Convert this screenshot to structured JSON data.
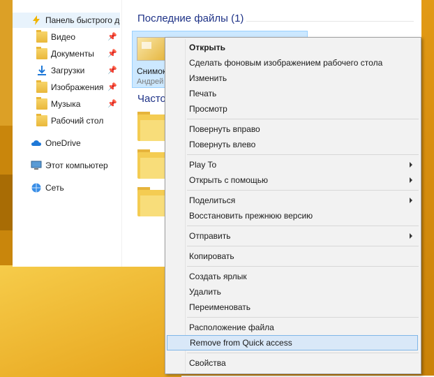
{
  "nav": {
    "quick_access": "Панель быстрого до",
    "pinned": [
      {
        "label": "Видео",
        "icon": "video-folder-icon"
      },
      {
        "label": "Документы",
        "icon": "documents-folder-icon"
      },
      {
        "label": "Загрузки",
        "icon": "downloads-folder-icon"
      },
      {
        "label": "Изображения",
        "icon": "pictures-folder-icon"
      },
      {
        "label": "Музыка",
        "icon": "music-folder-icon"
      },
      {
        "label": "Рабочий стол",
        "icon": "desktop-folder-icon"
      }
    ],
    "onedrive": "OneDrive",
    "this_pc": "Этот компьютер",
    "network": "Сеть"
  },
  "content": {
    "recent_header": "Последние файлы (1)",
    "recent_file_name": "Снимок",
    "recent_file_author": "Андрей",
    "frequent_header": "Часто"
  },
  "menu": {
    "items": [
      "Открыть",
      "Сделать фоновым изображением рабочего стола",
      "Изменить",
      "Печать",
      "Просмотр",
      "Повернуть вправо",
      "Повернуть влево",
      "Play To",
      "Открыть с помощью",
      "Поделиться",
      "Восстановить прежнюю версию",
      "Отправить",
      "Копировать",
      "Создать ярлык",
      "Удалить",
      "Переименовать",
      "Расположение файла",
      "Remove from Quick access",
      "Свойства"
    ]
  },
  "colors": {
    "accent_header": "#1e3287",
    "menu_highlight": "#d9e8f8",
    "selection": "#cce8ff"
  }
}
